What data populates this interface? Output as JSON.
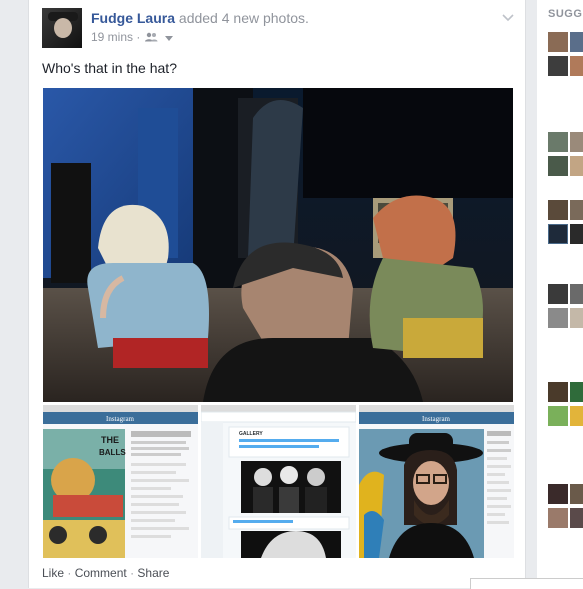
{
  "post": {
    "author": "Fudge Laura",
    "action": "added 4 new photos.",
    "time": "19 mins",
    "separator": "·",
    "caption": "Who's that in the hat?"
  },
  "post_actions": {
    "like": "Like",
    "comment": "Comment",
    "share": "Share",
    "dot": "·"
  },
  "thumbnails": {
    "t1_brand": "Instagram",
    "t1_poster_top": "THE",
    "t1_poster_balls": "BALLS",
    "t2_brand": "GALLERY",
    "t3_brand": "Instagram"
  },
  "sidebar": {
    "title": "SUGGE"
  },
  "icons": {
    "audience": "friends-icon",
    "dropdown": "chevron-down-icon"
  },
  "colors": {
    "link": "#365899",
    "muted": "#90949c",
    "text": "#1d2129"
  }
}
